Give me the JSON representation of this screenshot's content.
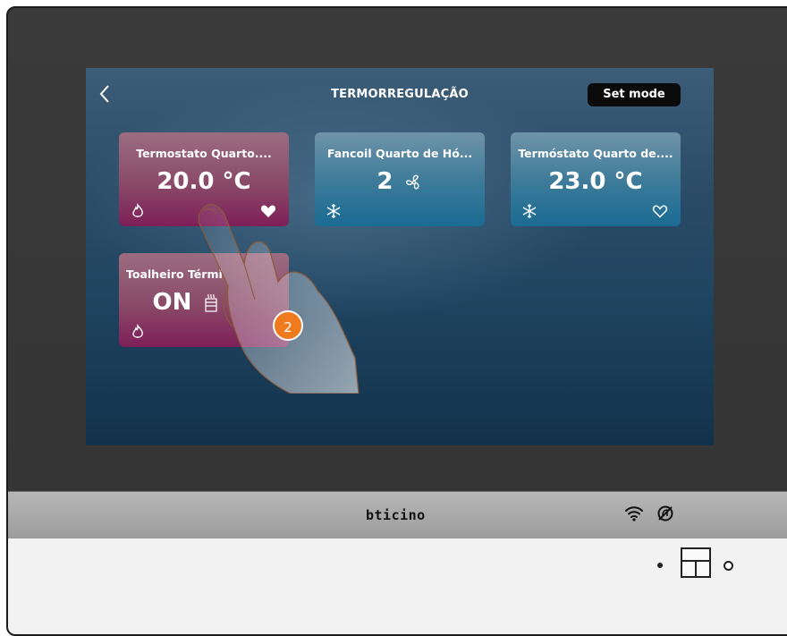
{
  "screen": {
    "title": "TERMORREGULAÇÃO",
    "set_mode_label": "Set mode"
  },
  "tiles": [
    {
      "name": "Termostato Quarto....",
      "value": "20.0 °C",
      "mode_icon": "flame-icon",
      "favorite": true,
      "color": "#8a3a66"
    },
    {
      "name": "Fancoil Quarto de Hó...",
      "value": "2",
      "value_icon": "fan-icon",
      "mode_icon": "snowflake-icon",
      "favorite": null,
      "color": "#1f6d92"
    },
    {
      "name": "Termóstato Quarto de....",
      "value": "23.0 °C",
      "mode_icon": "snowflake-icon",
      "favorite": false,
      "color": "#1f6d92"
    },
    {
      "name": "Toalheiro Térmi",
      "value": "ON",
      "value_icon": "towel-radiator-icon",
      "mode_icon": "flame-icon",
      "favorite": null,
      "color": "#8a3a66"
    }
  ],
  "device": {
    "brand": "bticino",
    "status_icons": [
      "wifi-icon",
      "do-not-disturb-icon"
    ]
  },
  "annotation": {
    "step_number": "2",
    "gesture": "tap"
  }
}
